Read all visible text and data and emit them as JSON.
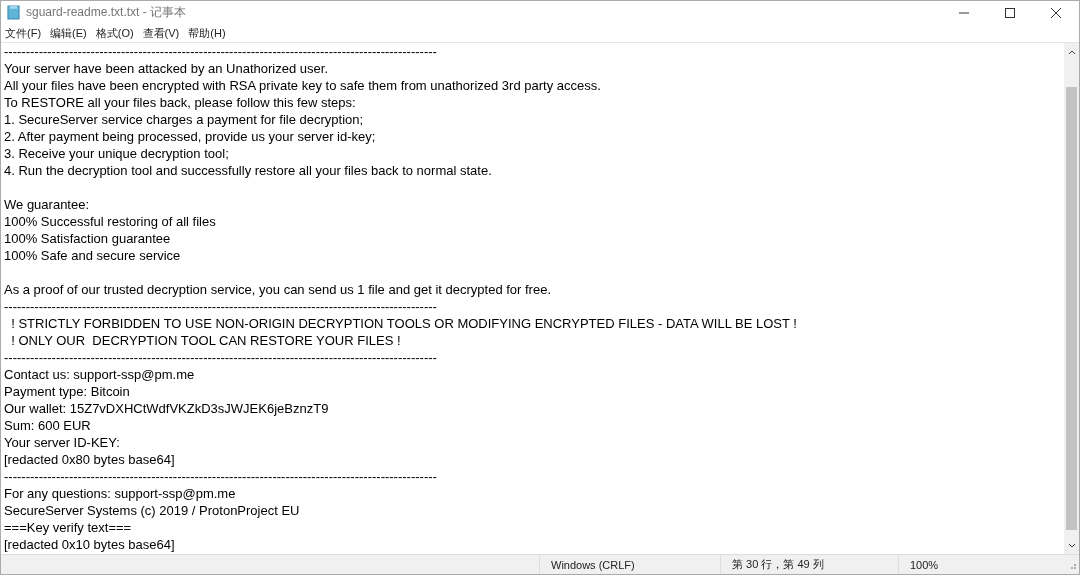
{
  "window": {
    "title": "sguard-readme.txt.txt - 记事本"
  },
  "menu": [
    "文件(F)",
    "编辑(E)",
    "格式(O)",
    "查看(V)",
    "帮助(H)"
  ],
  "paragraphs": [
    [
      "----------------------------------------------------------------------------------------------------",
      "Your server have been attacked by an Unathorized user.",
      "All your files have been encrypted with RSA private key to safe them from unathorized 3rd party access.",
      "To RESTORE all your files back, please follow this few steps:",
      "1. SecureServer service charges a payment for file decryption;",
      "2. After payment being processed, provide us your server id-key;",
      "3. Receive your unique decryption tool;",
      "4. Run the decryption tool and successfully restore all your files back to normal state."
    ],
    [
      "We guarantee:",
      "100% Successful restoring of all files",
      "100% Satisfaction guarantee",
      "100% Safe and secure service"
    ],
    [
      "As a proof of our trusted decryption service, you can send us 1 file and get it decrypted for free.",
      "----------------------------------------------------------------------------------------------------",
      "  ! STRICTLY FORBIDDEN TO USE NON-ORIGIN DECRYPTION TOOLS OR MODIFYING ENCRYPTED FILES - DATA WILL BE LOST !",
      "  ! ONLY OUR  DECRYPTION TOOL CAN RESTORE YOUR FILES !",
      "----------------------------------------------------------------------------------------------------",
      "Contact us: support-ssp@pm.me",
      "Payment type: Bitcoin",
      "Our wallet: 15Z7vDXHCtWdfVKZkD3sJWJEK6jeBznzT9",
      "Sum: 600 EUR",
      "Your server ID-KEY:",
      "[redacted 0x80 bytes base64]",
      "----------------------------------------------------------------------------------------------------",
      "For any questions: support-ssp@pm.me",
      "SecureServer Systems (c) 2019 / ProtonProject EU",
      "===Key verify text===",
      "[redacted 0x10 bytes base64]"
    ]
  ],
  "status_bar": [
    "Windows (CRLF)",
    "第 30 行，第 49 列",
    "100%"
  ]
}
